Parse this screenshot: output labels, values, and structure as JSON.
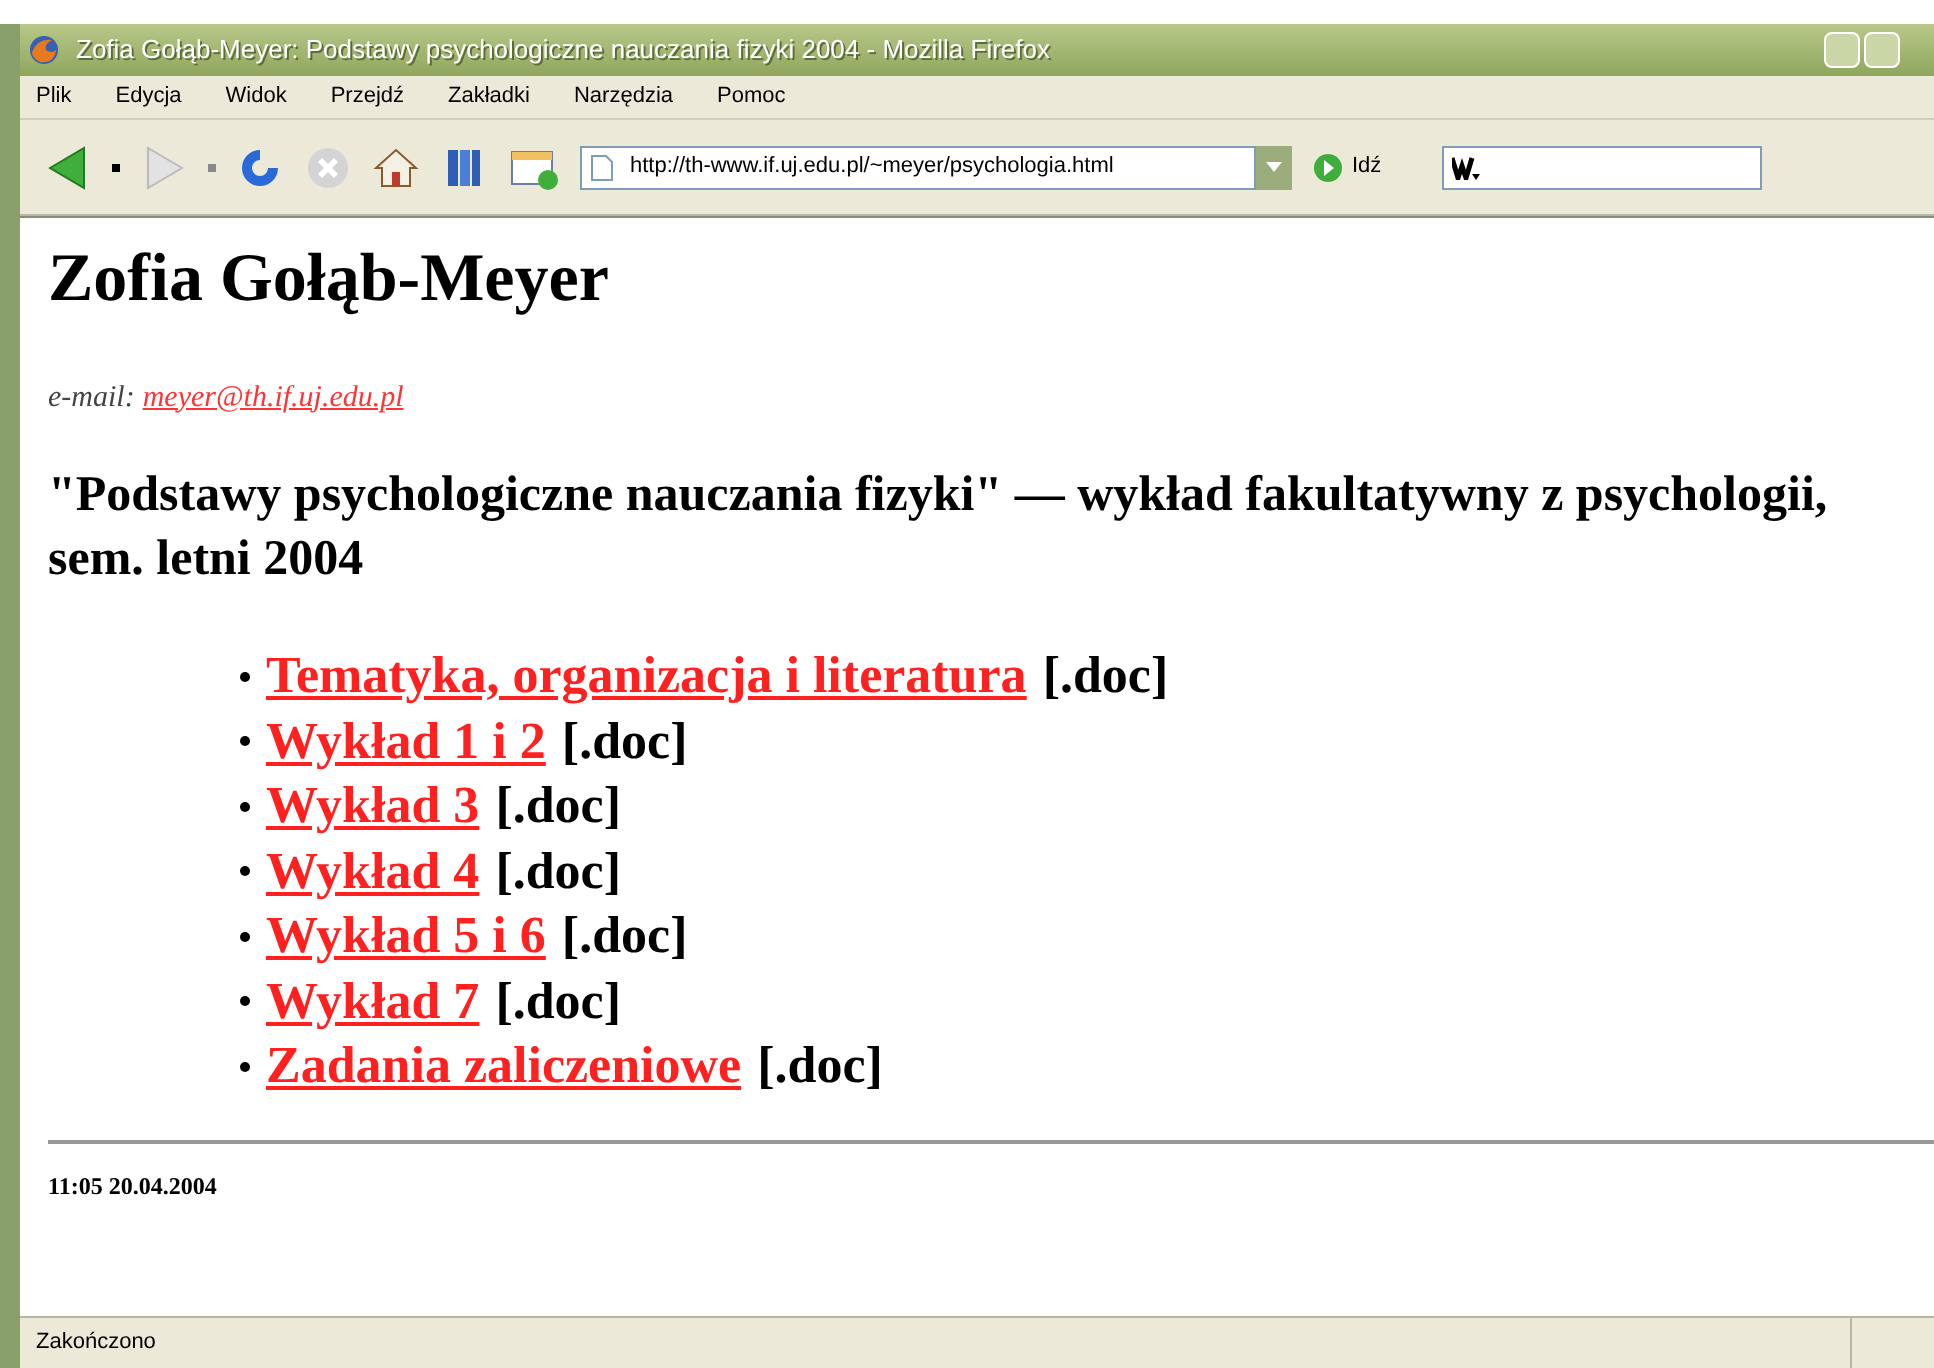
{
  "window": {
    "title": "Zofia Gołąb-Meyer: Podstawy psychologiczne nauczania fizyki 2004 - Mozilla Firefox"
  },
  "menu": [
    "Plik",
    "Edycja",
    "Widok",
    "Przejdź",
    "Zakładki",
    "Narzędzia",
    "Pomoc"
  ],
  "address_bar": {
    "value": "http://th-www.if.uj.edu.pl/~meyer/psychologia.html",
    "go_label": "Idź"
  },
  "page": {
    "heading": "Zofia Gołąb-Meyer",
    "email_label": "e-mail:",
    "email": "meyer@th.if.uj.edu.pl",
    "subtitle": "\"Podstawy psychologiczne nauczania fizyki\" — wykład fakultatywny z psychologii, sem. letni 2004",
    "items": [
      {
        "link": "Tematyka, organizacja i literatura",
        "suffix": "[.doc]"
      },
      {
        "link": "Wykład 1 i 2",
        "suffix": "[.doc]"
      },
      {
        "link": "Wykład 3",
        "suffix": "[.doc]"
      },
      {
        "link": "Wykład 4",
        "suffix": "[.doc]"
      },
      {
        "link": "Wykład 5 i 6",
        "suffix": "[.doc]"
      },
      {
        "link": "Wykład 7",
        "suffix": "[.doc]"
      },
      {
        "link": "Zadania zaliczeniowe",
        "suffix": "[.doc]"
      }
    ],
    "footer": "11:05 20.04.2004"
  },
  "status_bar": {
    "text": "Zakończono"
  }
}
